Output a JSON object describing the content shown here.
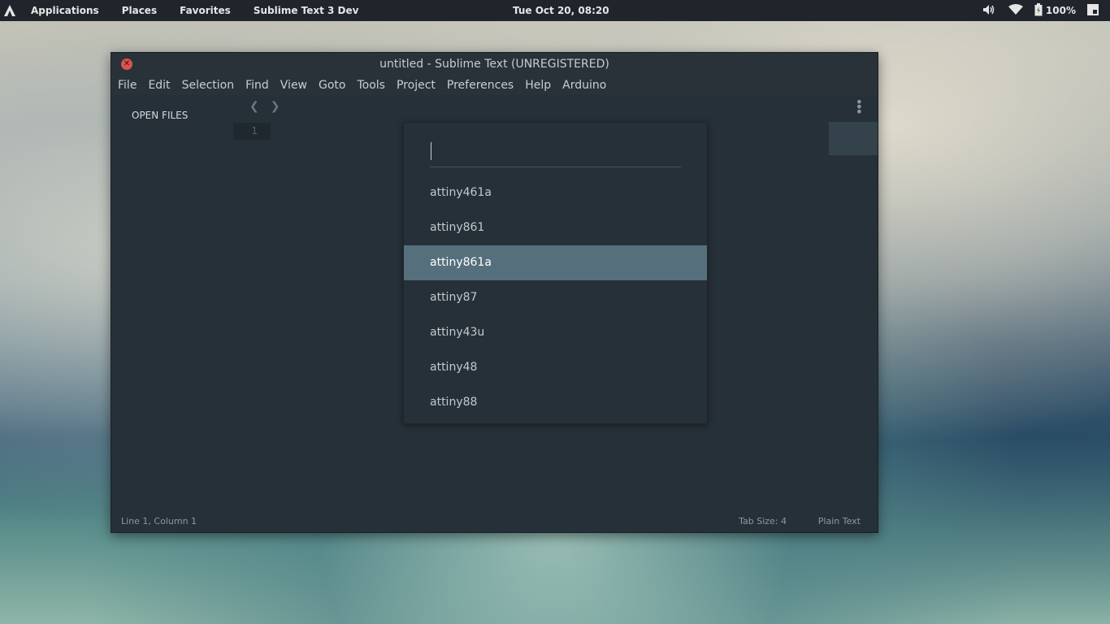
{
  "panel": {
    "menu": [
      "Applications",
      "Places",
      "Favorites",
      "Sublime Text 3 Dev"
    ],
    "clock": "Tue Oct 20, 08:20",
    "battery": "100%"
  },
  "window": {
    "title": "untitled - Sublime Text (UNREGISTERED)",
    "menu": [
      "File",
      "Edit",
      "Selection",
      "Find",
      "View",
      "Goto",
      "Tools",
      "Project",
      "Preferences",
      "Help",
      "Arduino"
    ],
    "sidebar_title": "OPEN FILES",
    "line_number": "1"
  },
  "quick_panel": {
    "input_value": "",
    "items": [
      "attiny461a",
      "attiny861",
      "attiny861a",
      "attiny87",
      "attiny43u",
      "attiny48",
      "attiny88"
    ],
    "selected_index": 2
  },
  "statusbar": {
    "position": "Line 1, Column 1",
    "tab_size": "Tab Size: 4",
    "syntax": "Plain Text"
  },
  "colors": {
    "accent": "#566f7c",
    "close": "#d9534f"
  }
}
